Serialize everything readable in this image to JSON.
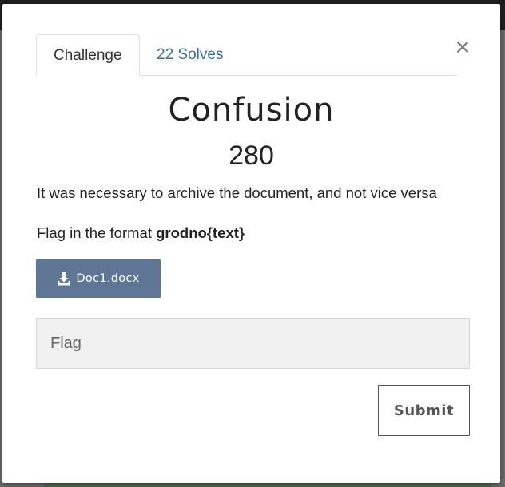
{
  "modal": {
    "close_symbol": "×",
    "tabs": [
      {
        "label": "Challenge",
        "active": true
      },
      {
        "label": "22 Solves",
        "active": false
      }
    ],
    "title": "Confusion",
    "points": "280",
    "description": "It was necessary to archive the document, and not vice versa",
    "flag_format_prefix": "Flag in the format ",
    "flag_format_value": "grodno{text}",
    "file": {
      "label": "Doc1.docx",
      "icon": "download-icon"
    },
    "flag_input": {
      "value": "",
      "placeholder": "Flag"
    },
    "submit_label": "Submit"
  },
  "colors": {
    "tab_link": "#3b6fa0",
    "file_button": "#5f7595",
    "input_bg": "#f0f0f0"
  }
}
